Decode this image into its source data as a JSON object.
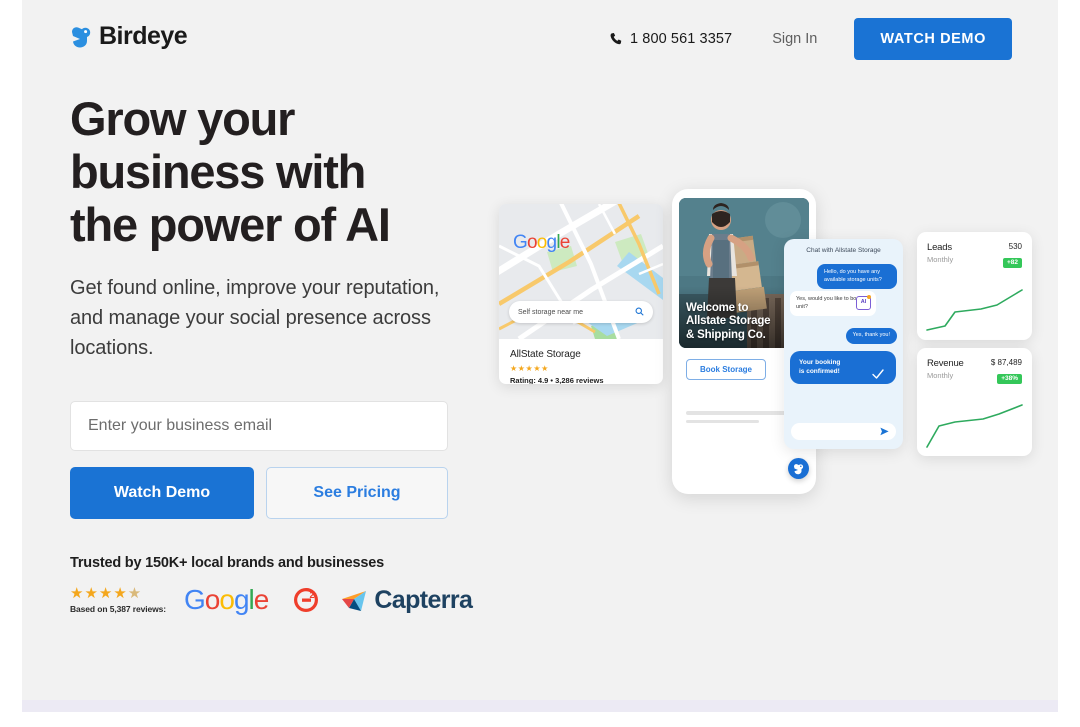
{
  "header": {
    "logo_text": "Birdeye",
    "logo_icon": "birdeye-bird-icon",
    "phone_icon": "phone-icon",
    "phone_number": "1 800 561 3357",
    "signin_label": "Sign In",
    "watch_demo_label": "WATCH DEMO"
  },
  "hero": {
    "headline_line1": "Grow your",
    "headline_line2": "business with",
    "headline_line3": "the power of AI",
    "subhead": "Get found online, improve your reputation, and manage your social presence across locations.",
    "email_placeholder": "Enter your business email",
    "email_value": "",
    "primary_cta": "Watch Demo",
    "secondary_cta": "See Pricing",
    "trusted_text": "Trusted by 150K+ local brands and businesses",
    "stars": "★★★★",
    "half_star": "★",
    "review_count": "Based on 5,387 reviews:",
    "google_letters": [
      "G",
      "o",
      "o",
      "g",
      "l",
      "e"
    ],
    "g2_label": "G2",
    "capterra_label": "Capterra"
  },
  "map_card": {
    "brand_letters": [
      "G",
      "o",
      "o",
      "g",
      "l",
      "e"
    ],
    "search_text": "Self storage near me",
    "search_icon": "magnifier-icon",
    "business_name": "AllState Storage",
    "stars": "★★★★★",
    "rating_line": "Rating: 4.9 • 3,286 reviews"
  },
  "phone": {
    "hero_title_line1": "Welcome to",
    "hero_title_line2": "Allstate Storage",
    "hero_title_line3": "& Shipping Co.",
    "book_button": "Book Storage"
  },
  "chat": {
    "title": "Chat with Allstate Storage",
    "msg_user_1": "Hello, do you have any available storage units?",
    "msg_agent_1": "Yes, would you like to book a unit?",
    "ai_chip": "AI",
    "msg_user_2": "Yes, thank you!",
    "msg_confirm_line1": "Your booking",
    "msg_confirm_line2": "is confirmed!",
    "check_icon": "check-icon",
    "send_icon": "send-icon",
    "fab_icon": "birdeye-bird-icon"
  },
  "stats": [
    {
      "name": "Leads",
      "period": "Monthly",
      "value": "530",
      "delta": "+82",
      "accent": "#34c759"
    },
    {
      "name": "Revenue",
      "period": "Monthly",
      "value": "$ 87,489",
      "delta": "+38%",
      "accent": "#34c759"
    }
  ],
  "chart_data": [
    {
      "type": "line",
      "title": "Leads",
      "x": [
        0,
        1,
        2,
        3,
        4,
        5
      ],
      "values": [
        8,
        18,
        42,
        46,
        52,
        88
      ],
      "ylabel": "",
      "xlabel": "",
      "color": "#2eaa5e",
      "grid": false
    },
    {
      "type": "line",
      "title": "Revenue",
      "x": [
        0,
        1,
        2,
        3,
        4,
        5
      ],
      "values": [
        6,
        44,
        52,
        56,
        70,
        92
      ],
      "ylabel": "",
      "xlabel": "",
      "color": "#2eaa5e",
      "grid": false
    }
  ],
  "colors": {
    "brand_blue": "#1a73d4",
    "page_bg": "#f2f2f2",
    "strip": "#eceaf4",
    "green": "#34c759",
    "star_gold": "#f4a71d"
  }
}
